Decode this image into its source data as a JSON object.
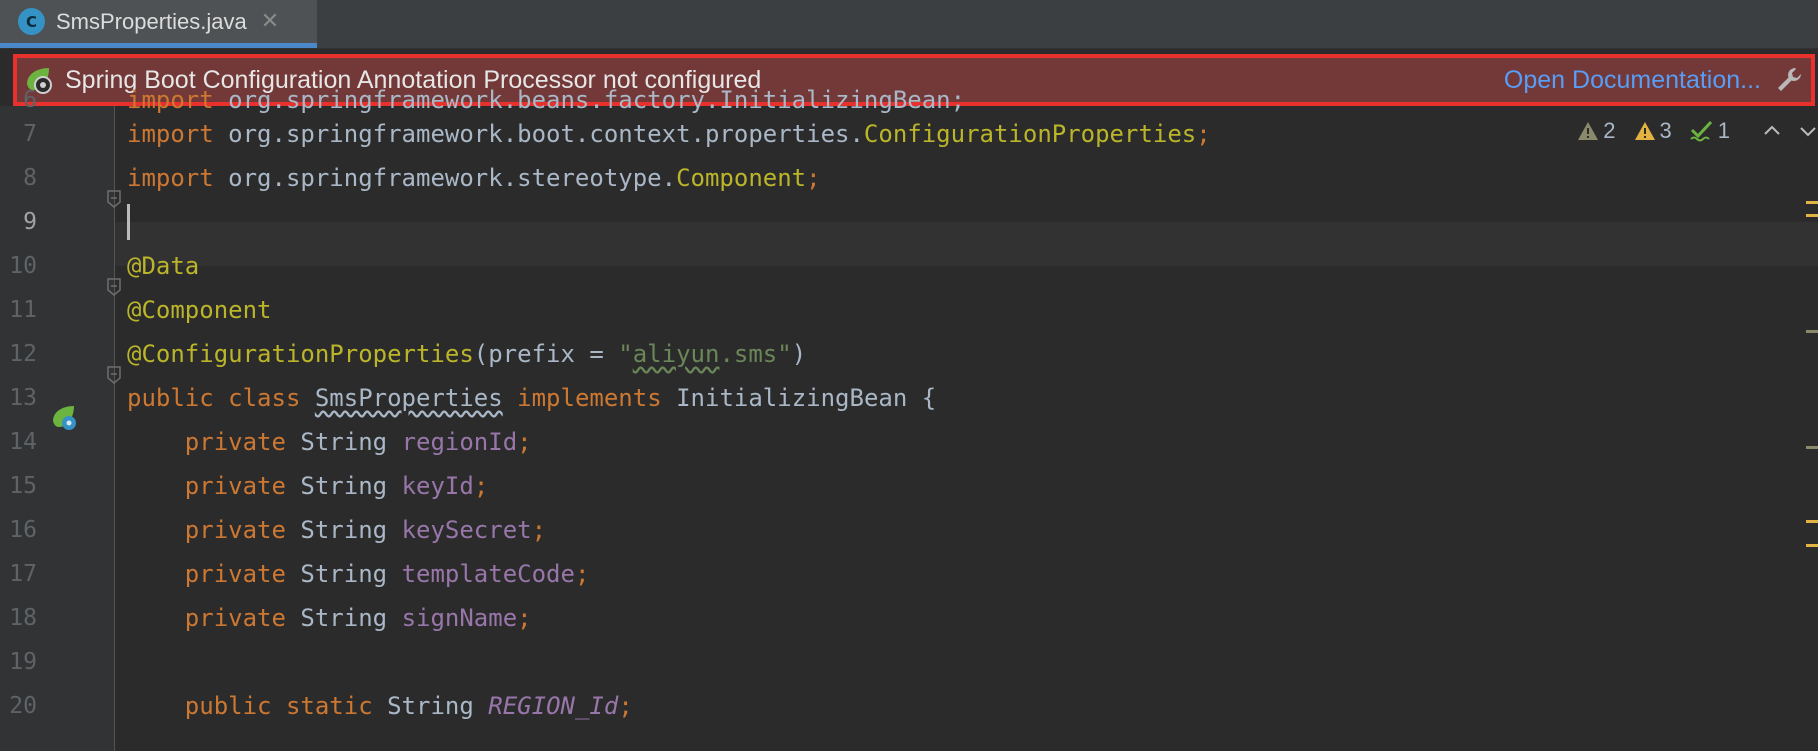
{
  "tab": {
    "icon_letter": "C",
    "label": "SmsProperties.java",
    "close": "✕"
  },
  "banner": {
    "text": "Spring Boot Configuration Annotation Processor not configured",
    "link": "Open Documentation...",
    "icons": [
      "spring-bean-icon",
      "wrench-icon"
    ]
  },
  "inspections": {
    "weak_warnings": "2",
    "warnings": "3",
    "typos": "1"
  },
  "line_numbers": [
    "6",
    "7",
    "8",
    "9",
    "10",
    "11",
    "12",
    "13",
    "14",
    "15",
    "16",
    "17",
    "18",
    "19",
    "20"
  ],
  "code": {
    "l6": {
      "kw": "import",
      "pkg": " org.springframework.beans.factory.InitializingBean;"
    },
    "l7": {
      "kw": "import",
      "pkg": " org.springframework.boot.context.properties.",
      "cls": "ConfigurationProperties",
      "end": ";"
    },
    "l8": {
      "kw": "import",
      "pkg": " org.springframework.stereotype.",
      "cls": "Component",
      "end": ";"
    },
    "l10": {
      "ann": "@Data"
    },
    "l11": {
      "ann": "@Component"
    },
    "l12": {
      "ann": "@ConfigurationProperties",
      "open": "(prefix = ",
      "q1": "\"",
      "str": "aliyun",
      "str2": ".sms",
      "q2": "\"",
      "close": ")"
    },
    "l13": {
      "kw1": "public",
      "kw2": "class",
      "name": "SmsProperties",
      "kw3": "implements",
      "iface": "InitializingBean {"
    },
    "fields": [
      {
        "kw": "private",
        "type": "String",
        "name": "regionId"
      },
      {
        "kw": "private",
        "type": "String",
        "name": "keyId"
      },
      {
        "kw": "private",
        "type": "String",
        "name": "keySecret"
      },
      {
        "kw": "private",
        "type": "String",
        "name": "templateCode"
      },
      {
        "kw": "private",
        "type": "String",
        "name": "signName"
      }
    ],
    "l20": {
      "kw1": "public",
      "kw2": "static",
      "type": "String",
      "name": "REGION_Id"
    }
  },
  "colors": {
    "keyword": "#cc7832",
    "annotation": "#bbb529",
    "string": "#6a8759",
    "field": "#9876aa",
    "text": "#a9b7c6",
    "banner_border": "#e8302c",
    "banner_bg": "#733838",
    "link": "#589df6"
  }
}
